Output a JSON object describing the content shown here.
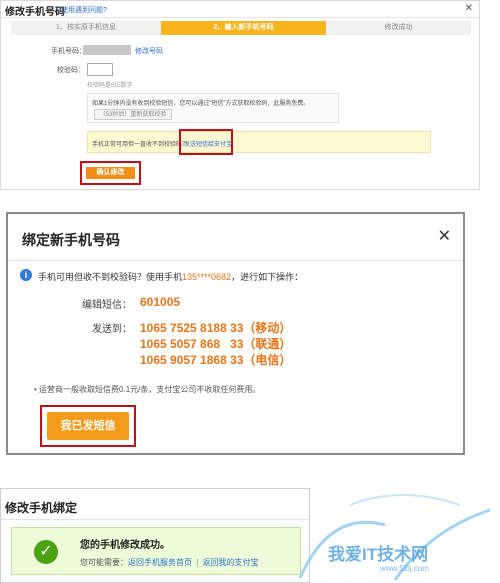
{
  "panel1": {
    "title": "修改手机号码",
    "help": "使用遇到问题?",
    "close": "✕",
    "steps": [
      "1、核实原手机信息",
      "2、输入新手机号码",
      "修改成功"
    ],
    "phone_label": "手机号码：",
    "modify_link": "修改号码",
    "code_label": "校验码：",
    "code_hint": "校验码是6位数字",
    "notice_text": "如果1分钟内没有收到校验短信，您可以通过“短信”方式获取校验码，此服务免费。",
    "resend_button": "（53秒后）重新获取校验",
    "yellow_text": "手机正常可用但一直收不到校验码？",
    "yellow_link": "发送短信给支付宝",
    "confirm_button": "确认修改"
  },
  "panel2": {
    "title": "绑定新手机号码",
    "close": "✕",
    "info_icon": "i",
    "info_pre": "手机可用但收不到校验码？使用手机",
    "info_phone": "135****0682",
    "info_post": "，进行如下操作：",
    "edit_label": "编辑短信：",
    "sms_code": "601005",
    "send_label": "发送到：",
    "numbers": [
      "1065 7525 8188 33（移动）",
      "1065 5057 868   33（联通）",
      "1065 9057 1868 33（电信）"
    ],
    "note": "• 运营商一般收取短信费0.1元/条，支付宝公司不收取任何费用。",
    "sent_button": "我已发短信"
  },
  "panel3": {
    "title": "修改手机绑定",
    "success_text": "您的手机修改成功。",
    "maybe_label": "您可能需要：",
    "link1": "返回手机服务首页",
    "separator": "|",
    "link2": "返回我的支付宝"
  },
  "watermark": {
    "text": "我爱IT技术网",
    "url": "www.52ij.com"
  }
}
